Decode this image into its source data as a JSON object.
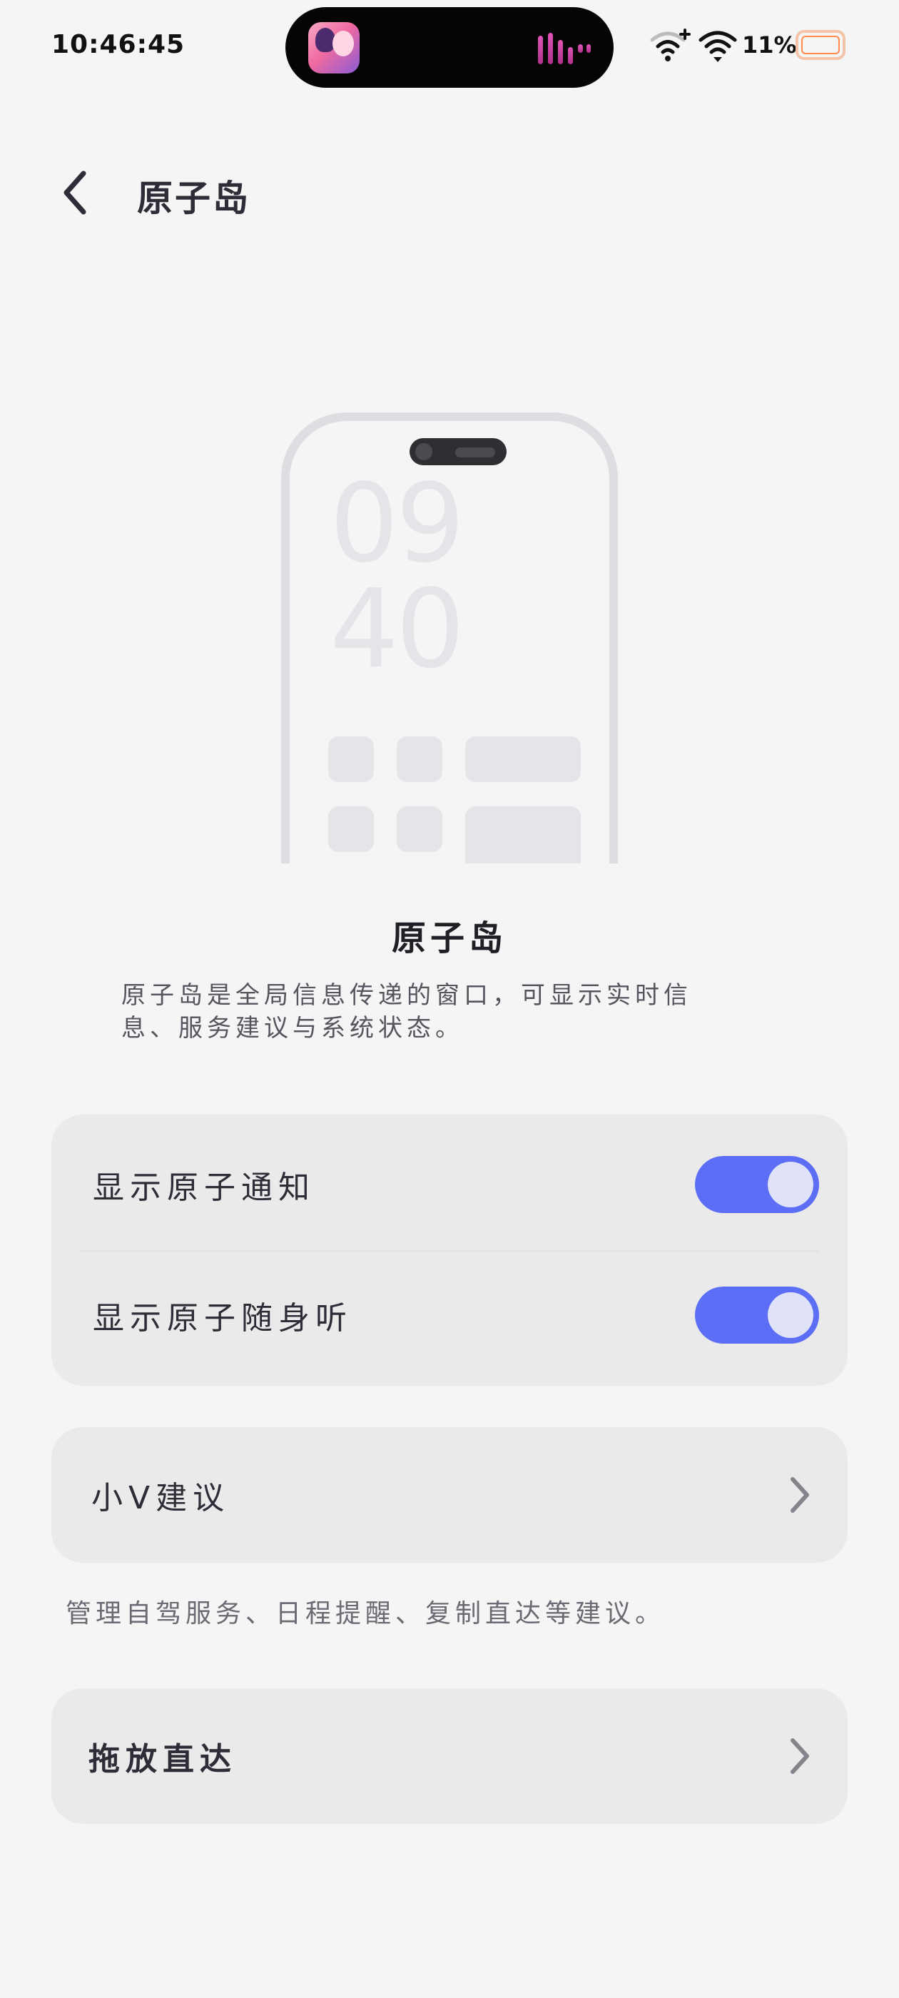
{
  "status_bar": {
    "time": "10:46:45",
    "battery_percent": "11%",
    "icons": [
      "app-avatar-icon",
      "audio-wave-icon",
      "wifi-plus-icon",
      "wifi-icon",
      "battery-icon"
    ]
  },
  "header": {
    "title": "原子岛",
    "back_icon": "chevron-left-icon"
  },
  "illustration": {
    "clock_hours": "09",
    "clock_minutes": "40"
  },
  "intro": {
    "title": "原子岛",
    "description": "原子岛是全局信息传递的窗口，可显示实时信息、服务建议与系统状态。"
  },
  "toggles": [
    {
      "label": "显示原子通知",
      "on": true
    },
    {
      "label": "显示原子随身听",
      "on": true
    }
  ],
  "links": {
    "suggestions": {
      "label": "小V建议",
      "note": "管理自驾服务、日程提醒、复制直达等建议。"
    },
    "drag_drop": {
      "label": "拖放直达"
    }
  },
  "colors": {
    "accent": "#5b6ef5",
    "background": "#f5f5f5",
    "card": "#eaeaea"
  }
}
